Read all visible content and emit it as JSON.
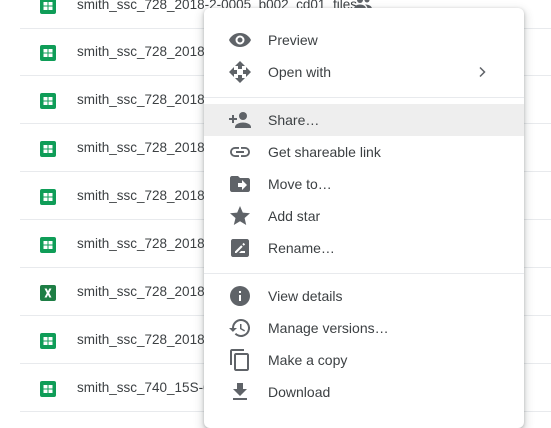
{
  "files": [
    {
      "name": "smith_ssc_728_2018-2-0005_b002_cd01_files",
      "type": "sheets",
      "shared": true
    },
    {
      "name": "smith_ssc_728_2018-",
      "type": "sheets"
    },
    {
      "name": "smith_ssc_728_2018-",
      "type": "sheets"
    },
    {
      "name": "smith_ssc_728_2018-",
      "type": "sheets"
    },
    {
      "name": "smith_ssc_728_2018-",
      "type": "sheets"
    },
    {
      "name": "smith_ssc_728_2018-",
      "type": "sheets"
    },
    {
      "name": "smith_ssc_728_2018-",
      "type": "excel"
    },
    {
      "name": "smith_ssc_728_2018S",
      "type": "sheets"
    },
    {
      "name": "smith_ssc_740_15S-0",
      "type": "sheets"
    }
  ],
  "context_menu": {
    "items": [
      {
        "label": "Preview",
        "icon": "eye-icon"
      },
      {
        "label": "Open with",
        "icon": "move-arrows-icon",
        "submenu": true
      },
      {
        "label": "Share…",
        "icon": "add-person-icon"
      },
      {
        "label": "Get shareable link",
        "icon": "link-icon"
      },
      {
        "label": "Move to…",
        "icon": "move-folder-icon"
      },
      {
        "label": "Add star",
        "icon": "star-icon"
      },
      {
        "label": "Rename…",
        "icon": "rename-icon"
      },
      {
        "label": "View details",
        "icon": "info-icon"
      },
      {
        "label": "Manage versions…",
        "icon": "history-icon"
      },
      {
        "label": "Make a copy",
        "icon": "copy-icon"
      },
      {
        "label": "Download",
        "icon": "download-icon"
      }
    ]
  },
  "colors": {
    "sheets_green": "#0f9d58",
    "excel_green": "#1e7e45",
    "icon_gray": "#5f6368",
    "hover_bg": "#eeeeee"
  }
}
